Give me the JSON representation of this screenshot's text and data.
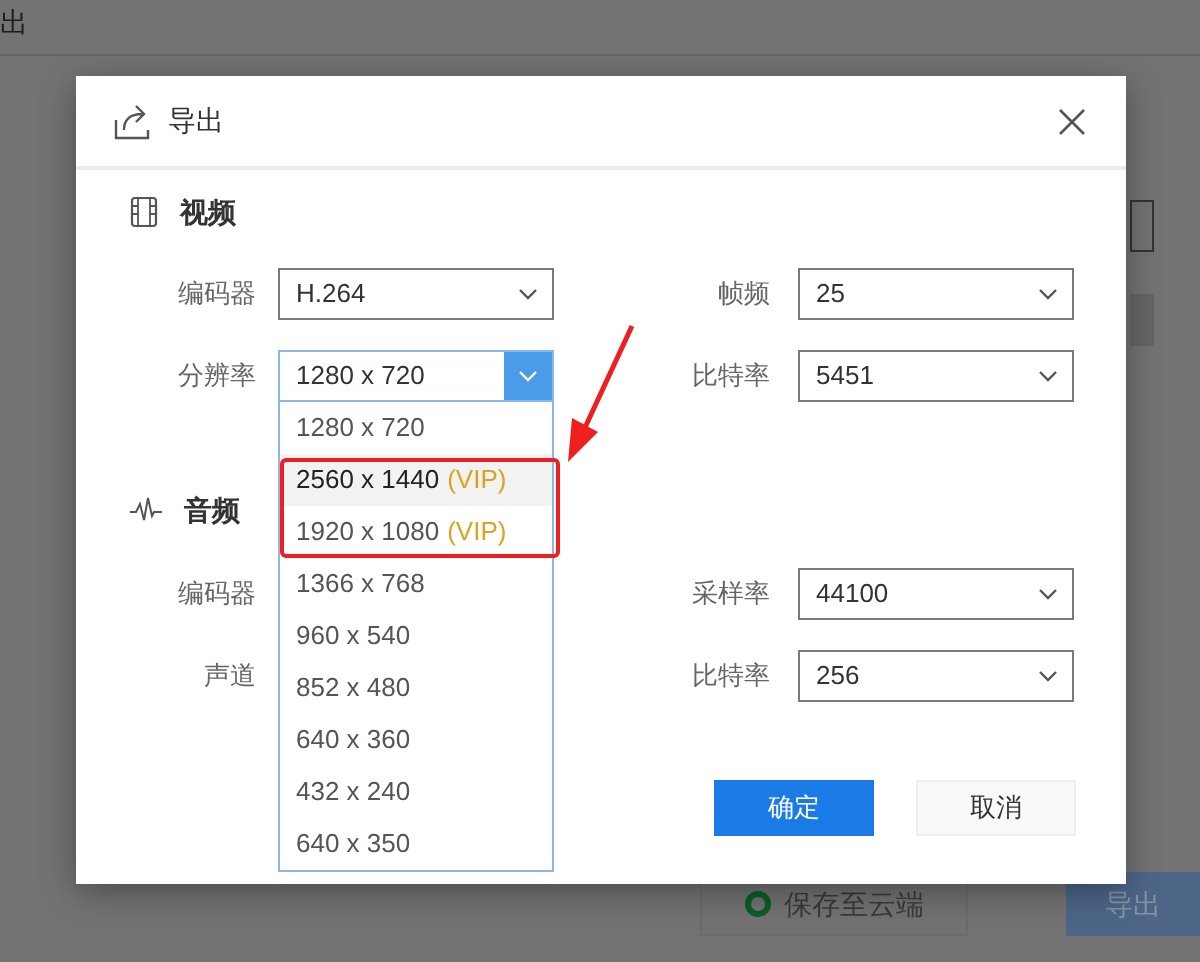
{
  "background": {
    "title": "出",
    "buttons": [
      {
        "label": "保存至云端",
        "kind": "cloud"
      },
      {
        "label": "导出",
        "kind": "primary"
      }
    ]
  },
  "dialog": {
    "title": "导出",
    "sections": [
      {
        "kind": "video",
        "title": "视频",
        "fields": [
          {
            "label": "编码器",
            "value": "H.264"
          },
          {
            "label": "帧频",
            "value": "25"
          },
          {
            "label": "分辨率",
            "value": "1280 x 720",
            "open": true
          },
          {
            "label": "比特率",
            "value": "5451"
          }
        ]
      },
      {
        "kind": "audio",
        "title": "音频",
        "fields": [
          {
            "label": "编码器"
          },
          {
            "label": "采样率",
            "value": "44100"
          },
          {
            "label": "声道"
          },
          {
            "label": "比特率",
            "value": "256"
          }
        ]
      }
    ],
    "dropdown": {
      "options": [
        {
          "label": "1280 x 720",
          "highlighted": false,
          "callout": false
        },
        {
          "label": "2560 x 1440",
          "badge": "(VIP)",
          "highlighted": true,
          "callout": true
        },
        {
          "label": "1920 x 1080",
          "badge": "(VIP)",
          "highlighted": false,
          "callout": true
        },
        {
          "label": "1366 x 768",
          "highlighted": false,
          "callout": false
        },
        {
          "label": "960 x 540",
          "highlighted": false,
          "callout": false
        },
        {
          "label": "852 x 480",
          "highlighted": false,
          "callout": false
        },
        {
          "label": "640 x 360",
          "highlighted": false,
          "callout": false
        },
        {
          "label": "432 x 240",
          "highlighted": false,
          "callout": false
        },
        {
          "label": "640 x 350",
          "highlighted": false,
          "callout": false
        }
      ]
    },
    "buttons": [
      {
        "label": "确定",
        "kind": "primary"
      },
      {
        "label": "取消",
        "kind": "secondary"
      }
    ]
  }
}
